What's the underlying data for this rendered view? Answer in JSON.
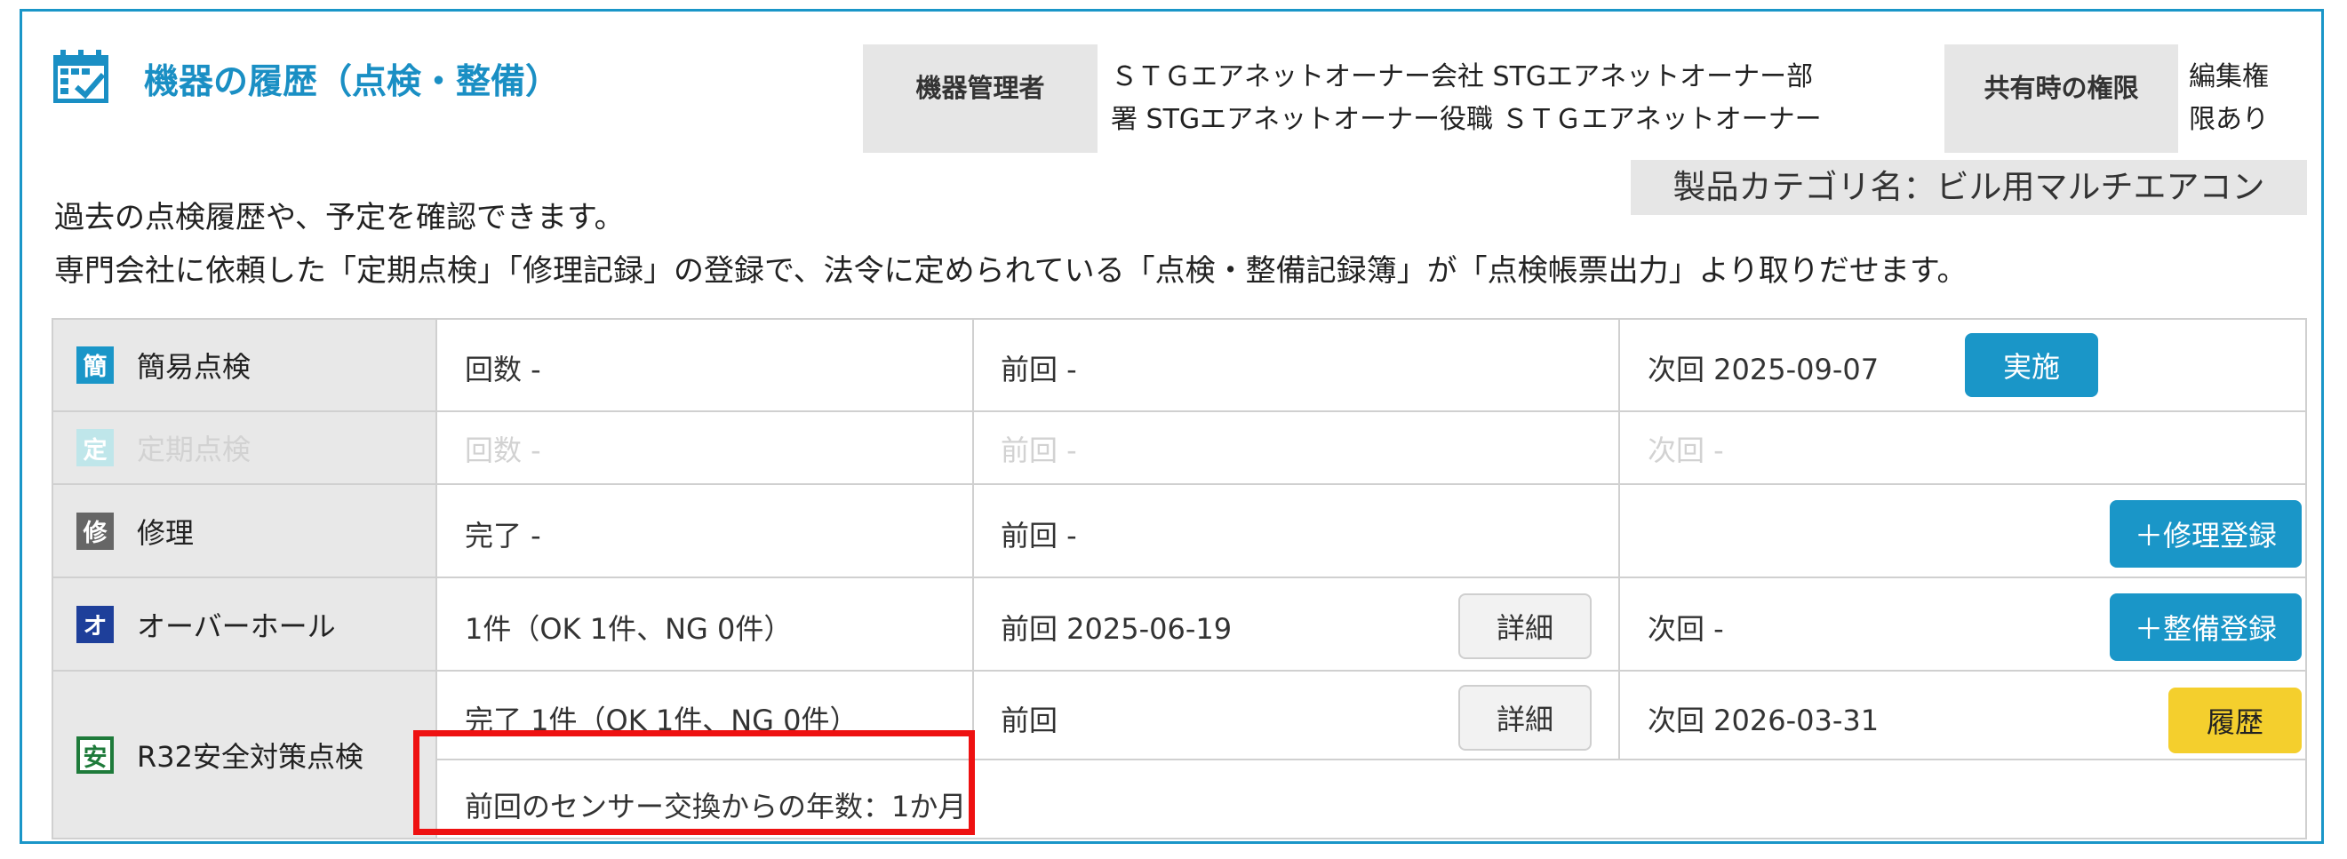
{
  "header": {
    "title": "機器の履歴（点検・整備）",
    "title_icon": "calendar-check-icon",
    "admin_label": "機器管理者",
    "admin_value_line1": "ＳＴＧエアネットオーナー会社 STGエアネットオーナー部",
    "admin_value_line2": "署 STGエアネットオーナー役職 ＳＴＧエアネットオーナー",
    "permission_label": "共有時の権限",
    "permission_value_line1": "編集権",
    "permission_value_line2": "限あり",
    "category": "製品カテゴリ名：ビル用マルチエアコン"
  },
  "description": {
    "line1": "過去の点検履歴や、予定を確認できます。",
    "line2": "専門会社に依頼した「定期点検」「修理記録」の登録で、法令に定められている「点検・整備記録簿」が「点検帳票出力」より取りだせます。"
  },
  "rows": {
    "simple": {
      "badge": "簡",
      "label": "簡易点検",
      "count": "回数 -",
      "prev": "前回 -",
      "next": "次回 2025-09-07",
      "action": "実施"
    },
    "periodic": {
      "badge": "定",
      "label": "定期点検",
      "count": "回数 -",
      "prev": "前回 -",
      "next": "次回 -"
    },
    "repair": {
      "badge": "修",
      "label": "修理",
      "status": "完了 -",
      "prev": "前回 -",
      "action": "＋修理登録"
    },
    "overhaul": {
      "badge": "オ",
      "label": "オーバーホール",
      "status": "1件（OK 1件、NG 0件）",
      "prev": "前回 2025-06-19",
      "detail": "詳細",
      "next": "次回 -",
      "action": "＋整備登録"
    },
    "r32": {
      "badge": "安",
      "label": "R32安全対策点検",
      "status": "完了 1件（OK 1件、NG 0件）",
      "prev": "前回",
      "detail": "詳細",
      "next": "次回 2026-03-31",
      "action": "履歴",
      "sensor": "前回のセンサー交換からの年数：1か月"
    }
  },
  "colors": {
    "accent": "#1a96c8",
    "history_button": "#f4cf2d",
    "highlight": "#ee1111",
    "badge_simple": "#1a96c8",
    "badge_periodic": "#7fd0d8",
    "badge_repair": "#666666",
    "badge_overhaul": "#1e3f9a",
    "badge_r32": "#1e7a3a"
  }
}
